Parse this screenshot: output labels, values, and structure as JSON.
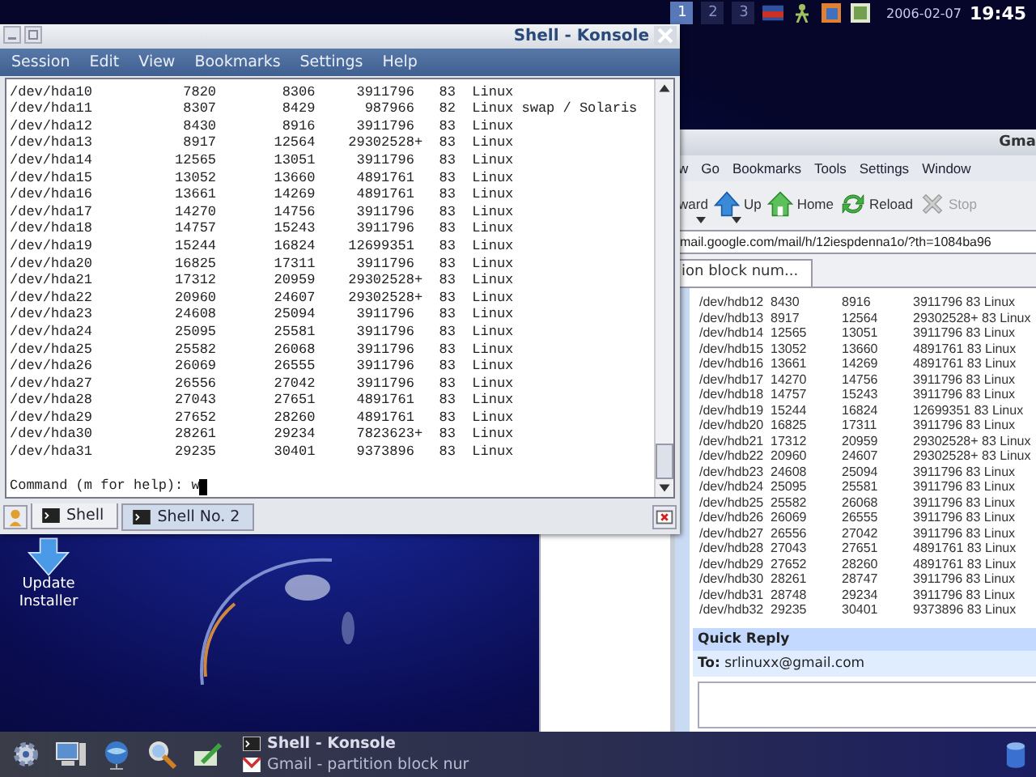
{
  "top_panel": {
    "desktops": [
      {
        "label": "1",
        "selected": true
      },
      {
        "label": "2",
        "selected": false
      },
      {
        "label": "3",
        "selected": false
      }
    ],
    "date": "2006-02-07",
    "time": "19:45"
  },
  "desktop_icons": [
    {
      "label": "Update Installer"
    }
  ],
  "konsole": {
    "title": "Shell - Konsole",
    "menu": [
      "Session",
      "Edit",
      "View",
      "Bookmarks",
      "Settings",
      "Help"
    ],
    "lines": [
      "/dev/hda10           7820        8306     3911796   83  Linux",
      "/dev/hda11           8307        8429      987966   82  Linux swap / Solaris",
      "/dev/hda12           8430        8916     3911796   83  Linux",
      "/dev/hda13           8917       12564    29302528+  83  Linux",
      "/dev/hda14          12565       13051     3911796   83  Linux",
      "/dev/hda15          13052       13660     4891761   83  Linux",
      "/dev/hda16          13661       14269     4891761   83  Linux",
      "/dev/hda17          14270       14756     3911796   83  Linux",
      "/dev/hda18          14757       15243     3911796   83  Linux",
      "/dev/hda19          15244       16824    12699351   83  Linux",
      "/dev/hda20          16825       17311     3911796   83  Linux",
      "/dev/hda21          17312       20959    29302528+  83  Linux",
      "/dev/hda22          20960       24607    29302528+  83  Linux",
      "/dev/hda23          24608       25094     3911796   83  Linux",
      "/dev/hda24          25095       25581     3911796   83  Linux",
      "/dev/hda25          25582       26068     3911796   83  Linux",
      "/dev/hda26          26069       26555     3911796   83  Linux",
      "/dev/hda27          26556       27042     3911796   83  Linux",
      "/dev/hda28          27043       27651     4891761   83  Linux",
      "/dev/hda29          27652       28260     4891761   83  Linux",
      "/dev/hda30          28261       29234     7823623+  83  Linux",
      "/dev/hda31          29235       30401     9373896   83  Linux"
    ],
    "prompt": "Command (m for help): w",
    "tabs": [
      {
        "label": "Shell",
        "selected": true
      },
      {
        "label": "Shell No. 2",
        "selected": false
      }
    ]
  },
  "browser": {
    "title": "Gma",
    "menu": [
      "w",
      "Go",
      "Bookmarks",
      "Tools",
      "Settings",
      "Window"
    ],
    "toolbar": [
      {
        "label": "ward",
        "kind": "forward",
        "disabled": false
      },
      {
        "label": "Up",
        "kind": "up",
        "disabled": false
      },
      {
        "label": "Home",
        "kind": "home",
        "disabled": false
      },
      {
        "label": "Reload",
        "kind": "reload",
        "disabled": false
      },
      {
        "label": "Stop",
        "kind": "stop",
        "disabled": true
      }
    ],
    "address": "mail.google.com/mail/h/12iespdenna1o/?th=1084ba96",
    "tabs": [
      {
        "label": "ion block num...",
        "selected": true
      }
    ],
    "message_lines": [
      "/dev/hdb12\t8430\t8916\t3911796 83 Linux",
      "/dev/hdb13\t8917\t12564\t29302528+ 83 Linux",
      "/dev/hdb14\t12565\t13051\t3911796 83 Linux",
      "/dev/hdb15\t13052\t13660\t4891761 83 Linux",
      "/dev/hdb16\t13661\t14269\t4891761 83 Linux",
      "/dev/hdb17\t14270\t14756\t3911796 83 Linux",
      "/dev/hdb18\t14757\t15243\t3911796 83 Linux",
      "/dev/hdb19\t15244\t16824\t12699351 83 Linux",
      "/dev/hdb20\t16825\t17311\t3911796 83 Linux",
      "/dev/hdb21\t17312\t20959\t29302528+ 83 Linux",
      "/dev/hdb22\t20960\t24607\t29302528+ 83 Linux",
      "/dev/hdb23\t24608\t25094\t3911796 83 Linux",
      "/dev/hdb24\t25095\t25581\t3911796 83 Linux",
      "/dev/hdb25\t25582\t26068\t3911796 83 Linux",
      "/dev/hdb26\t26069\t26555\t3911796 83 Linux",
      "/dev/hdb27\t26556\t27042\t3911796 83 Linux",
      "/dev/hdb28\t27043\t27651\t4891761 83 Linux",
      "/dev/hdb29\t27652\t28260\t4891761 83 Linux",
      "/dev/hdb30\t28261\t28747\t3911796 83 Linux",
      "/dev/hdb31\t28748\t29234\t3911796 83 Linux",
      "/dev/hdb32\t29235\t30401\t9373896 83 Linux"
    ],
    "quick_reply": {
      "title": "Quick Reply",
      "to": "**To:** srlinuxx@gmail.com"
    }
  },
  "taskbar": {
    "tasks": [
      {
        "label": "Shell - Konsole",
        "selected": true
      },
      {
        "label": "Gmail - partition block nur",
        "selected": false
      }
    ]
  }
}
